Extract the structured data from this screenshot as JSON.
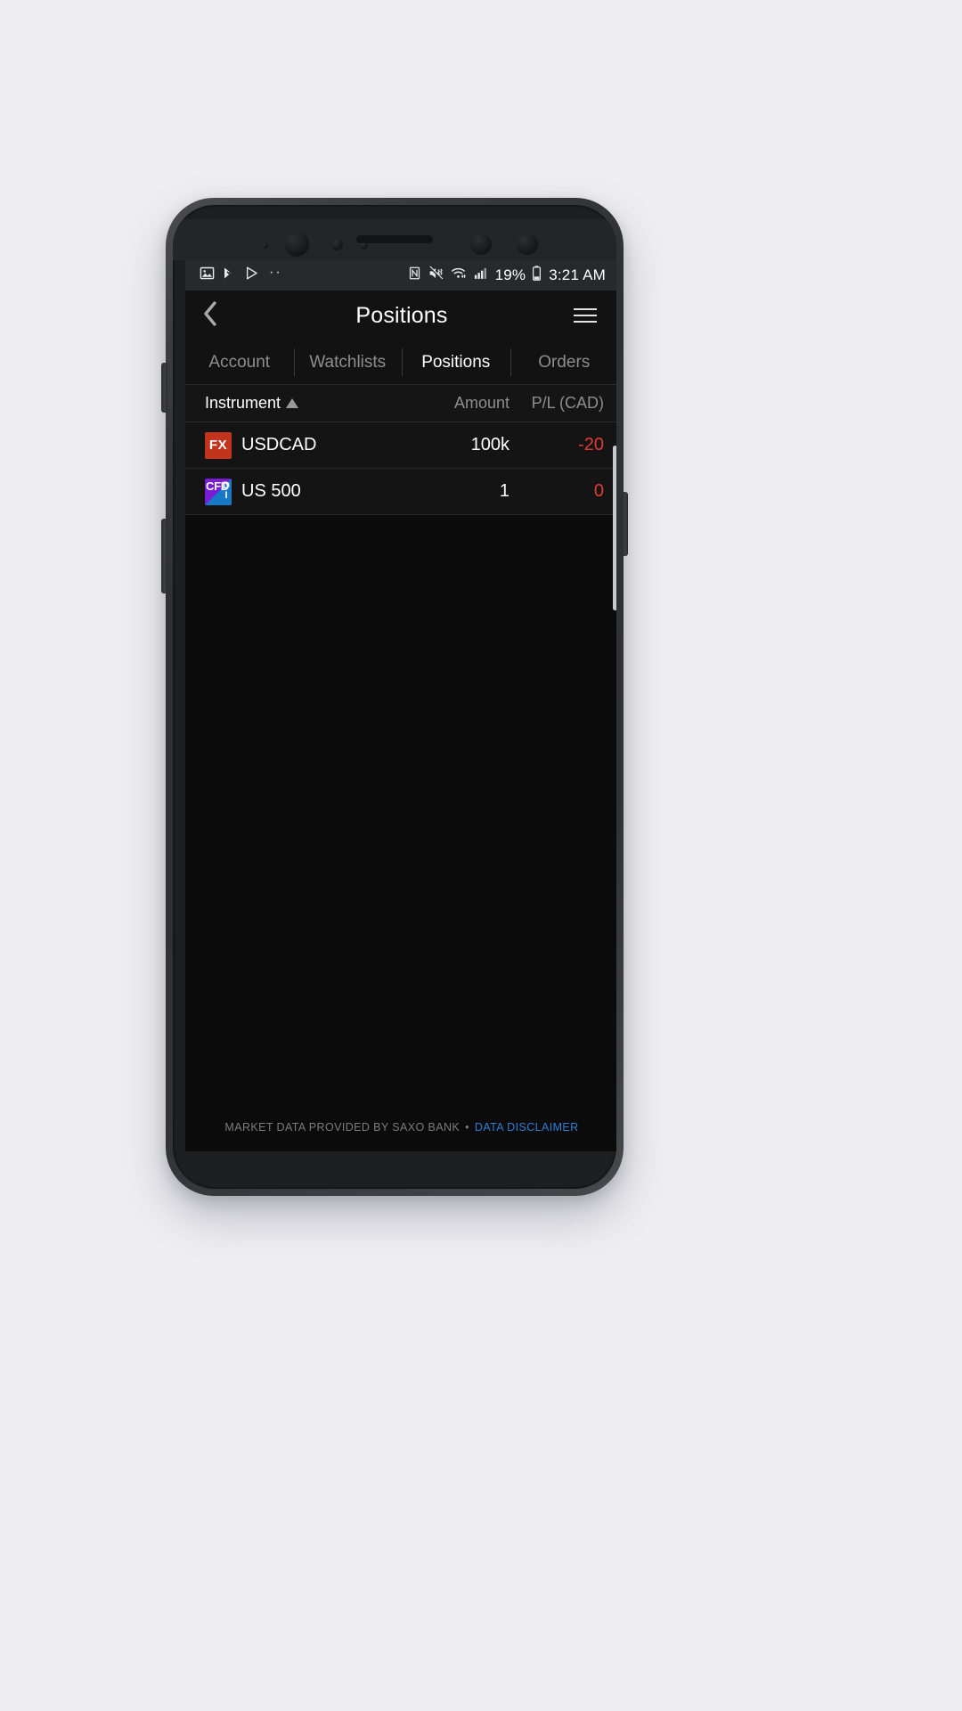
{
  "status_bar": {
    "left_icons": [
      "gallery-icon",
      "vlc-icon",
      "play-store-icon"
    ],
    "overflow_dots": "··",
    "right_icons": [
      "nfc-icon",
      "vibrate-mute-icon",
      "wifi-icon",
      "cellular-signal-icon"
    ],
    "battery_percent": "19%",
    "battery_icon": "battery-icon",
    "time": "3:21 AM"
  },
  "header": {
    "back_icon": "chevron-left-icon",
    "title": "Positions",
    "menu_icon": "hamburger-menu-icon"
  },
  "tabs": [
    {
      "label": "Account",
      "active": false
    },
    {
      "label": "Watchlists",
      "active": false
    },
    {
      "label": "Positions",
      "active": true
    },
    {
      "label": "Orders",
      "active": false
    }
  ],
  "table": {
    "columns": {
      "instrument": "Instrument",
      "sort_icon": "sort-ascending-icon",
      "amount": "Amount",
      "pl": "P/L (CAD)"
    },
    "rows": [
      {
        "badge": "FX",
        "badge_type": "fx-badge",
        "instrument": "USDCAD",
        "amount": "100k",
        "pl": "-20",
        "pl_color": "#e03c31"
      },
      {
        "badge": "CFD",
        "badge_sub": "D\nI",
        "badge_type": "cfd-badge",
        "instrument": "US 500",
        "amount": "1",
        "pl": "0",
        "pl_color": "#e03c31"
      }
    ]
  },
  "footer": {
    "text": "MARKET DATA PROVIDED BY SAXO BANK",
    "separator": "•",
    "link": "DATA DISCLAIMER"
  },
  "colors": {
    "accent_link": "#2f7fd6",
    "negative": "#e03c31",
    "fx_badge": "#c3341f",
    "cfd_badge_purple": "#7a1bd6",
    "cfd_badge_blue": "#1878c8",
    "screen_bg": "#0b0b0b"
  }
}
